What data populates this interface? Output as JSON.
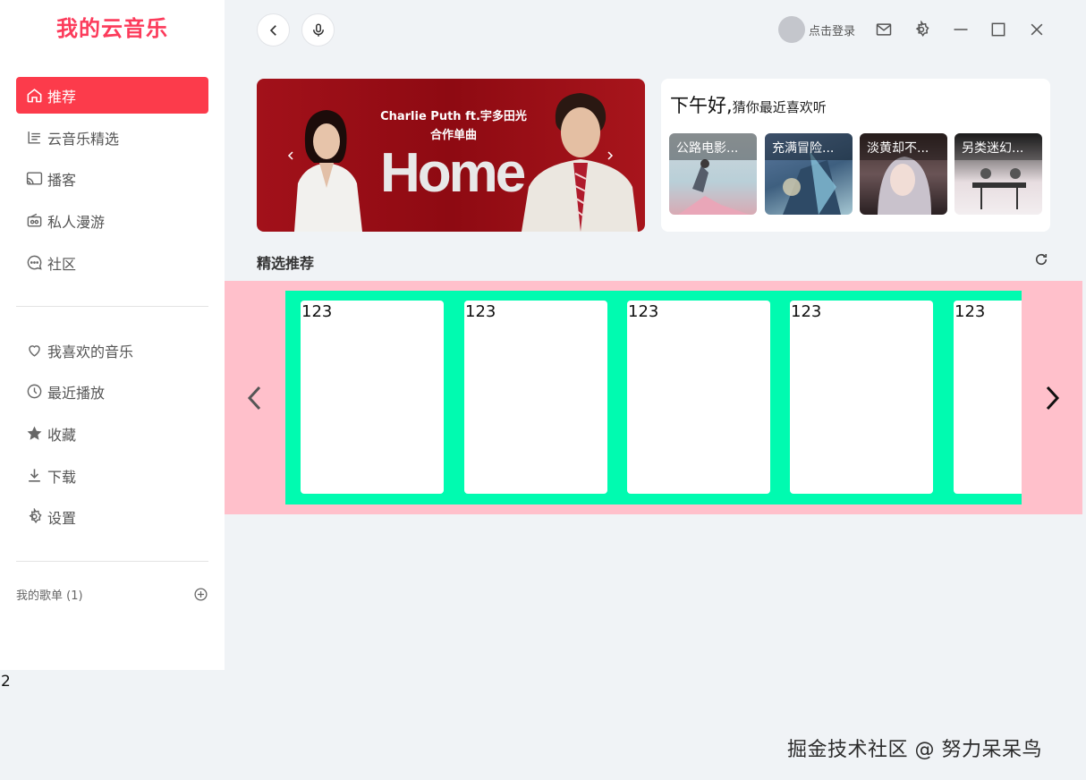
{
  "app": {
    "brand": "我的云音乐"
  },
  "sidebar": {
    "main_items": [
      {
        "label": "推荐",
        "icon": "home-icon",
        "active": true
      },
      {
        "label": "云音乐精选",
        "icon": "list-icon"
      },
      {
        "label": "播客",
        "icon": "cast-icon"
      },
      {
        "label": "私人漫游",
        "icon": "radio-icon"
      },
      {
        "label": "社区",
        "icon": "chat-icon"
      }
    ],
    "my_items": [
      {
        "label": "我喜欢的音乐",
        "icon": "heart-icon"
      },
      {
        "label": "最近播放",
        "icon": "clock-icon"
      },
      {
        "label": "收藏",
        "icon": "star-icon"
      },
      {
        "label": "下载",
        "icon": "download-icon"
      },
      {
        "label": "设置",
        "icon": "gear-icon"
      }
    ],
    "playlist_label": "我的歌单 (1)"
  },
  "header": {
    "login_text": "点击登录"
  },
  "banner": {
    "subtitle_line1": "Charlie Puth ft.宇多田光",
    "subtitle_line2": "合作单曲",
    "title": "Home"
  },
  "greeting": {
    "title": "下午好,",
    "subtitle": "猜你最近喜欢听",
    "items": [
      {
        "label": "公路电影..."
      },
      {
        "label": "充满冒险..."
      },
      {
        "label": "淡黄却不..."
      },
      {
        "label": "另类迷幻..."
      }
    ]
  },
  "section": {
    "title": "精选推荐"
  },
  "carousel": {
    "cards": [
      {
        "text": "123"
      },
      {
        "text": "123"
      },
      {
        "text": "123"
      },
      {
        "text": "123"
      },
      {
        "text": "123"
      }
    ]
  },
  "misc": {
    "stray_text": "2",
    "watermark": "掘金技术社区 @ 努力呆呆鸟"
  },
  "colors": {
    "accent": "#fc3b4b",
    "carousel_bg": "#ffc0cb",
    "carousel_track": "#00fbb0"
  }
}
